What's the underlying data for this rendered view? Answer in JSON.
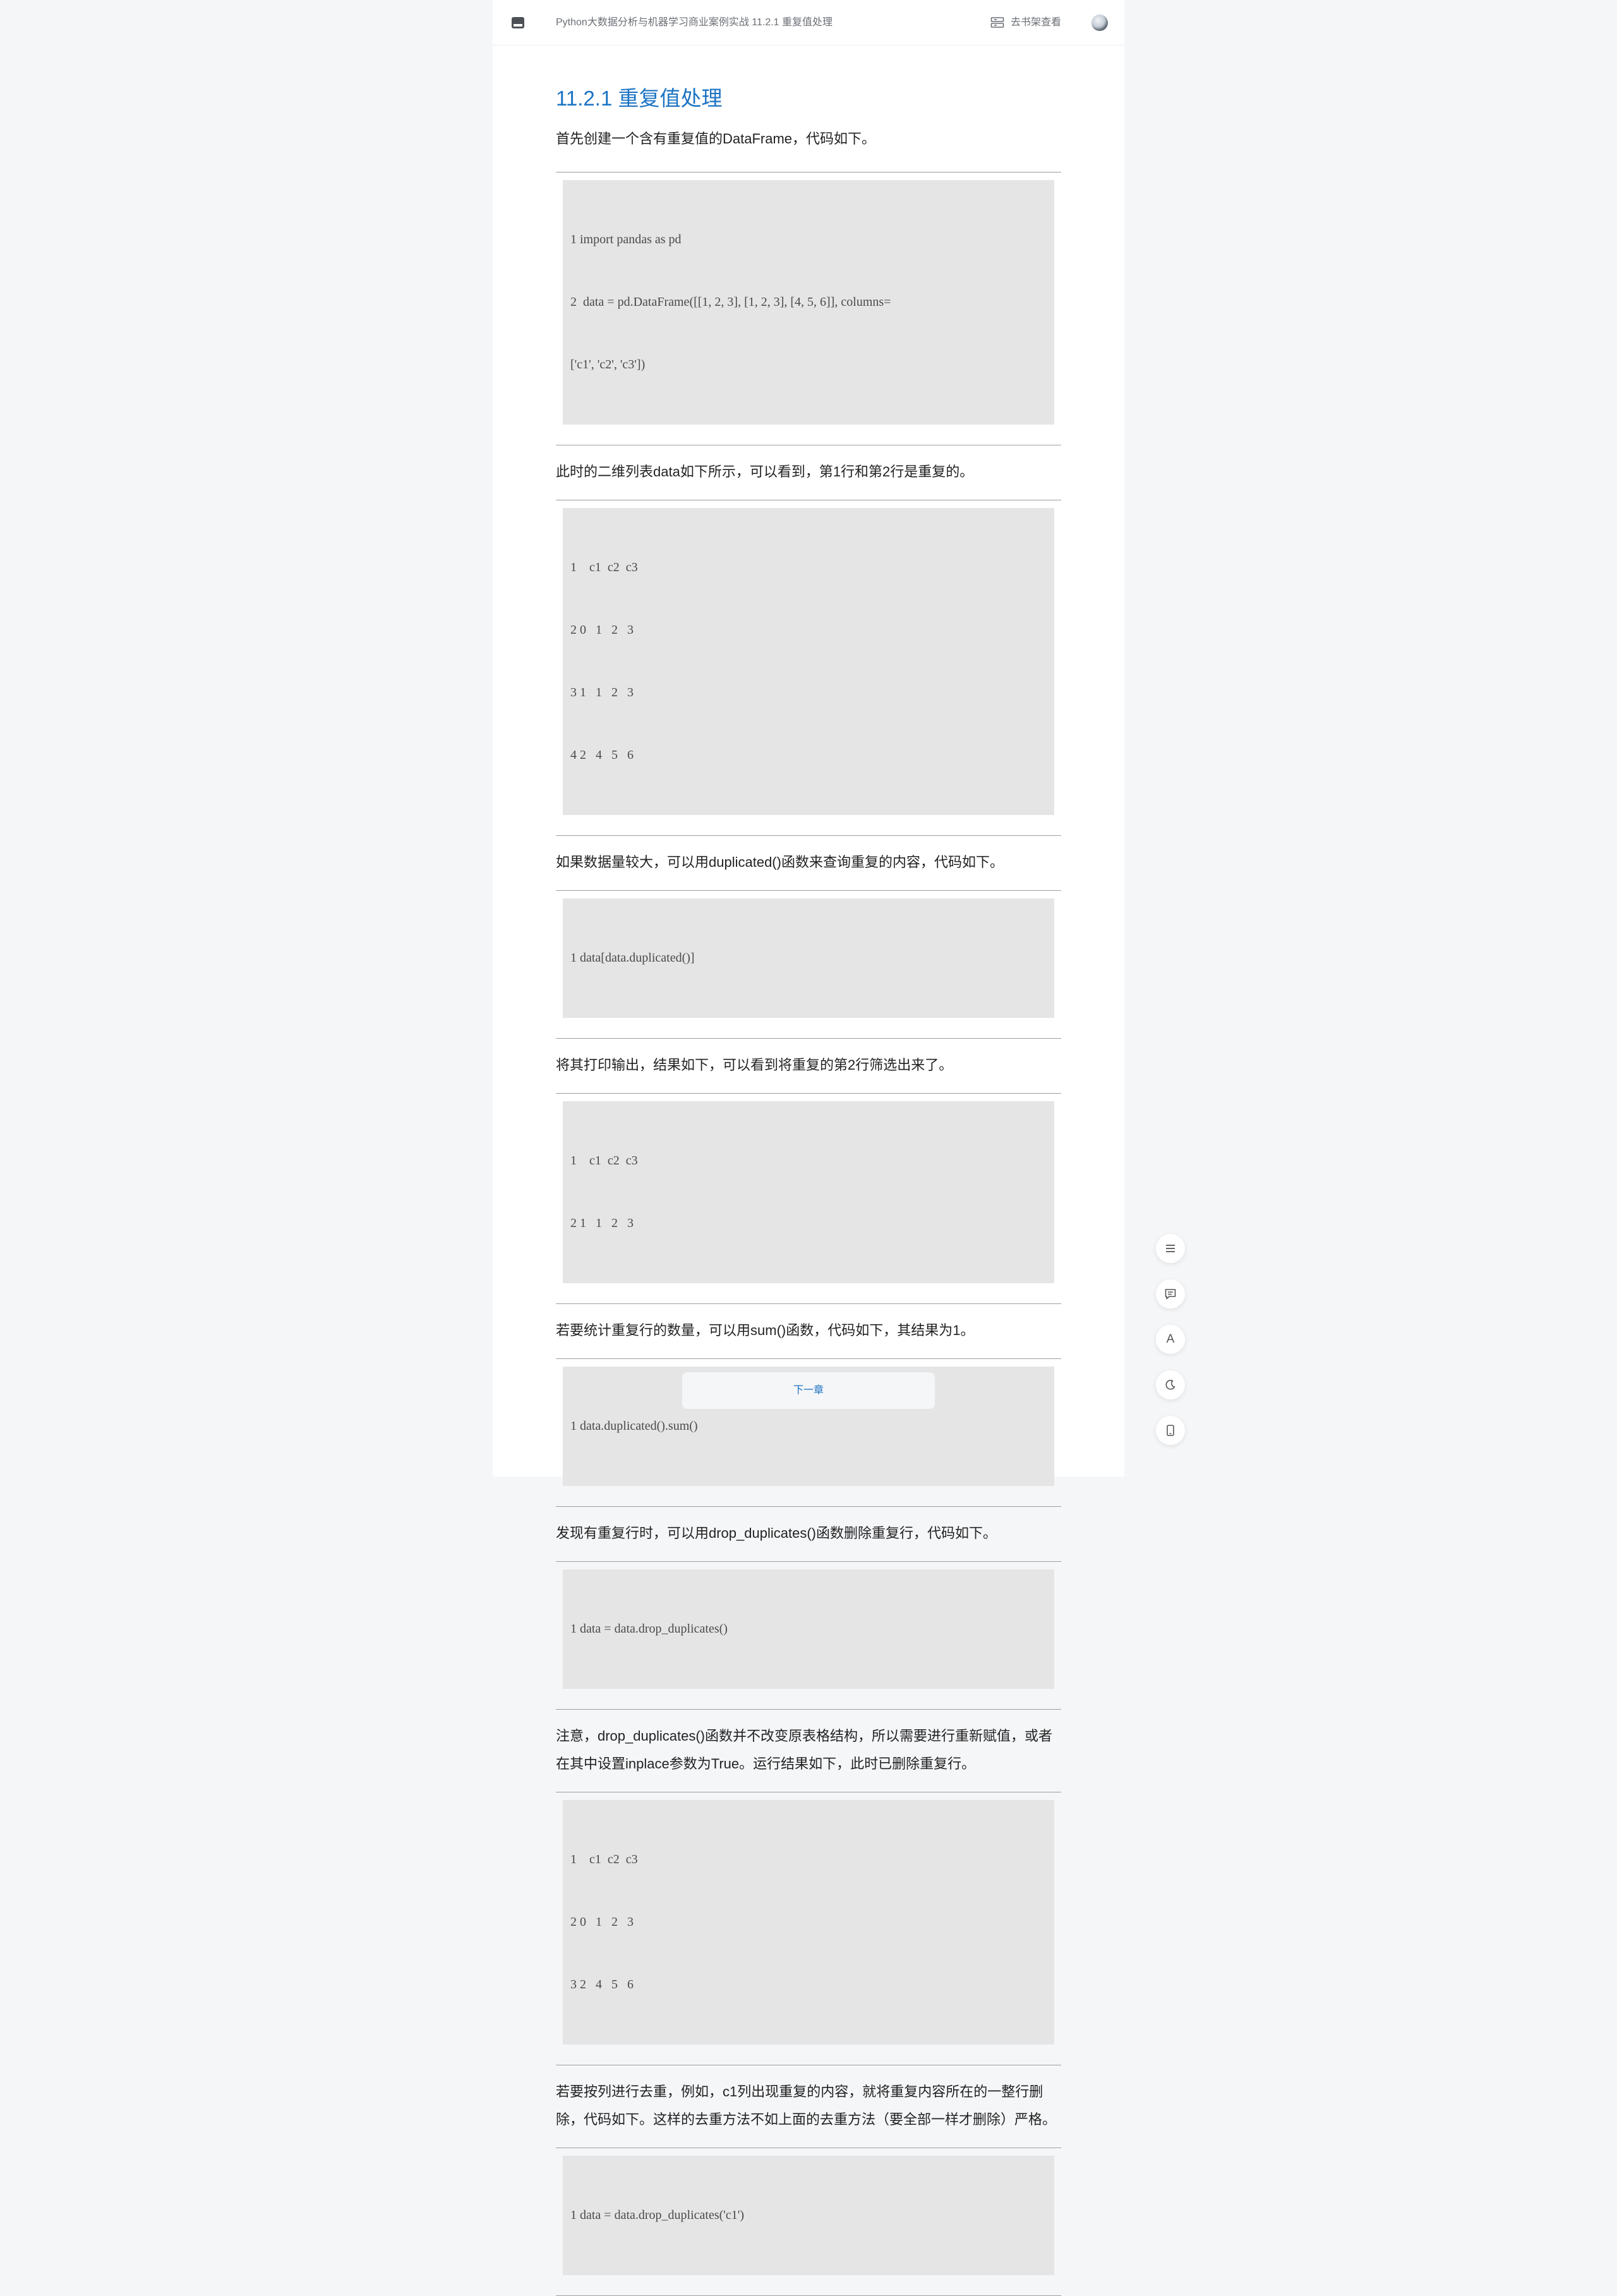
{
  "header": {
    "book_title": "Python大数据分析与机器学习商业案例实战 11.2.1 重复值处理",
    "shelf_link": "去书架查看",
    "menu_icon": "catalog-icon",
    "avatar": "avatar"
  },
  "article": {
    "heading": "11.2.1 重复值处理",
    "blocks": [
      {
        "type": "para",
        "text": "首先创建一个含有重复值的DataFrame，代码如下。"
      },
      {
        "type": "code",
        "lines": [
          "1 import pandas as pd",
          "2  data = pd.DataFrame([[1, 2, 3], [1, 2, 3], [4, 5, 6]], columns=",
          "['c1', 'c2', 'c3'])"
        ]
      },
      {
        "type": "para",
        "text": "此时的二维列表data如下所示，可以看到，第1行和第2行是重复的。"
      },
      {
        "type": "code",
        "lines": [
          "1    c1  c2  c3",
          "2 0   1   2   3",
          "3 1   1   2   3",
          "4 2   4   5   6"
        ]
      },
      {
        "type": "para",
        "text": "如果数据量较大，可以用duplicated()函数来查询重复的内容，代码如下。"
      },
      {
        "type": "code",
        "lines": [
          "1 data[data.duplicated()]"
        ]
      },
      {
        "type": "para",
        "text": "将其打印输出，结果如下，可以看到将重复的第2行筛选出来了。"
      },
      {
        "type": "code",
        "lines": [
          "1    c1  c2  c3",
          "2 1   1   2   3"
        ]
      },
      {
        "type": "para",
        "text": "若要统计重复行的数量，可以用sum()函数，代码如下，其结果为1。"
      },
      {
        "type": "code",
        "lines": [
          "1 data.duplicated().sum()"
        ]
      },
      {
        "type": "para",
        "text": "发现有重复行时，可以用drop_duplicates()函数删除重复行，代码如下。"
      },
      {
        "type": "code",
        "lines": [
          "1 data = data.drop_duplicates()"
        ]
      },
      {
        "type": "para",
        "text": "注意，drop_duplicates()函数并不改变原表格结构，所以需要进行重新赋值，或者在其中设置inplace参数为True。运行结果如下，此时已删除重复行。"
      },
      {
        "type": "code",
        "lines": [
          "1    c1  c2  c3",
          "2 0   1   2   3",
          "3 2   4   5   6"
        ]
      },
      {
        "type": "para",
        "text": "若要按列进行去重，例如，c1列出现重复的内容，就将重复内容所在的一整行删除，代码如下。这样的去重方法不如上面的去重方法（要全部一样才删除）严格。"
      },
      {
        "type": "code",
        "lines": [
          "1 data = data.drop_duplicates('c1')"
        ]
      }
    ],
    "next_chapter": "下一章"
  },
  "side_tools": {
    "catalog": "list-icon",
    "comments": "comment-icon",
    "font": "A",
    "dark_mode": "moon-icon",
    "mobile": "phone-icon"
  }
}
